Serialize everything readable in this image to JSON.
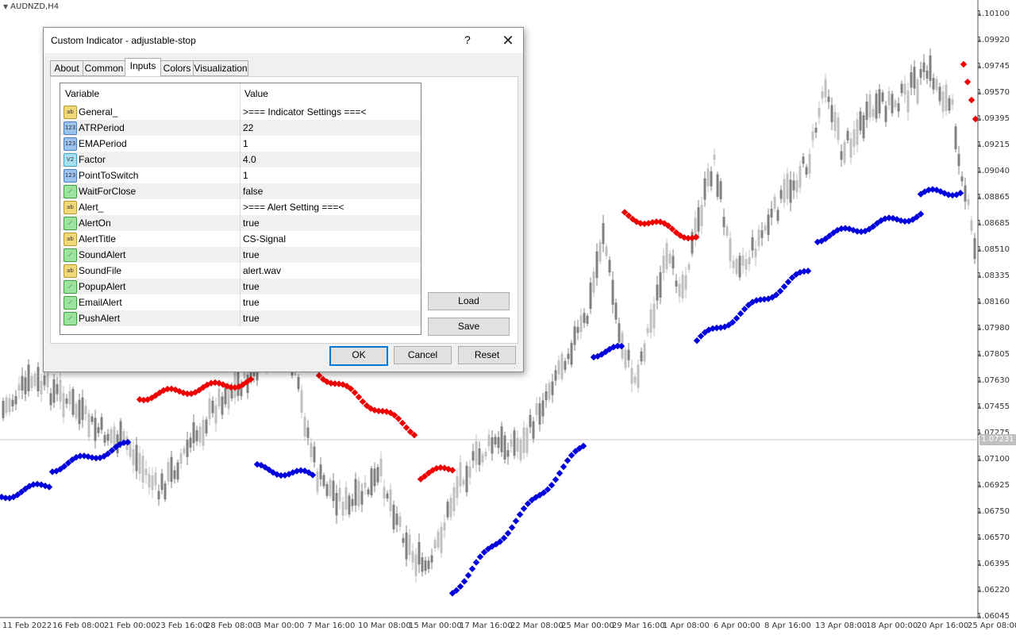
{
  "chart": {
    "symbol": "AUDNZD,H4",
    "current_price": "1.07231",
    "price_axis": [
      "1.10100",
      "1.09920",
      "1.09745",
      "1.09570",
      "1.09395",
      "1.09215",
      "1.09040",
      "1.08865",
      "1.08685",
      "1.08510",
      "1.08335",
      "1.08160",
      "1.07980",
      "1.07805",
      "1.07630",
      "1.07455",
      "1.07275",
      "1.07100",
      "1.06925",
      "1.06750",
      "1.06570",
      "1.06395",
      "1.06220",
      "1.06045"
    ],
    "time_axis": [
      "11 Feb 2022",
      "16 Feb 08:00",
      "21 Feb 00:00",
      "23 Feb 16:00",
      "28 Feb 08:00",
      "3 Mar 00:00",
      "7 Mar 16:00",
      "10 Mar 08:00",
      "15 Mar 00:00",
      "17 Mar 16:00",
      "22 Mar 08:00",
      "25 Mar 00:00",
      "29 Mar 16:00",
      "1 Apr 08:00",
      "6 Apr 00:00",
      "8 Apr 16:00",
      "13 Apr 08:00",
      "18 Apr 00:00",
      "20 Apr 16:00",
      "25 Apr 08:00"
    ],
    "colors": {
      "up_stop": "#0000dd",
      "down_stop": "#ee0000",
      "candle_up": "#c0c0c0",
      "candle_down": "#808080"
    }
  },
  "dialog": {
    "title": "Custom Indicator - adjustable-stop",
    "help": "?",
    "close": "✕",
    "tabs": [
      "About",
      "Common",
      "Inputs",
      "Colors",
      "Visualization"
    ],
    "active_tab": "Inputs",
    "columns": {
      "variable": "Variable",
      "value": "Value"
    },
    "params": [
      {
        "name": "General_",
        "value": ">=== Indicator Settings ===<",
        "icon": "ab",
        "icon_text": "ab"
      },
      {
        "name": "ATRPeriod",
        "value": "22",
        "icon": "n123",
        "icon_text": "123"
      },
      {
        "name": "EMAPeriod",
        "value": "1",
        "icon": "n123",
        "icon_text": "123"
      },
      {
        "name": "Factor",
        "value": "4.0",
        "icon": "v2",
        "icon_text": "V2"
      },
      {
        "name": "PointToSwitch",
        "value": "1",
        "icon": "n123",
        "icon_text": "123"
      },
      {
        "name": "WaitForClose",
        "value": "false",
        "icon": "bool",
        "icon_text": "⟋"
      },
      {
        "name": "Alert_",
        "value": ">=== Alert Setting ===<",
        "icon": "ab",
        "icon_text": "ab"
      },
      {
        "name": "AlertOn",
        "value": "true",
        "icon": "bool",
        "icon_text": "⟋"
      },
      {
        "name": "AlertTitle",
        "value": "CS-Signal",
        "icon": "ab",
        "icon_text": "ab"
      },
      {
        "name": "SoundAlert",
        "value": "true",
        "icon": "bool",
        "icon_text": "⟋"
      },
      {
        "name": "SoundFile",
        "value": "alert.wav",
        "icon": "ab",
        "icon_text": "ab"
      },
      {
        "name": "PopupAlert",
        "value": "true",
        "icon": "bool",
        "icon_text": "⟋"
      },
      {
        "name": "EmailAlert",
        "value": "true",
        "icon": "bool",
        "icon_text": "⟋"
      },
      {
        "name": "PushAlert",
        "value": "true",
        "icon": "bool",
        "icon_text": "⟋"
      }
    ],
    "buttons": {
      "load": "Load",
      "save": "Save",
      "ok": "OK",
      "cancel": "Cancel",
      "reset": "Reset"
    }
  }
}
